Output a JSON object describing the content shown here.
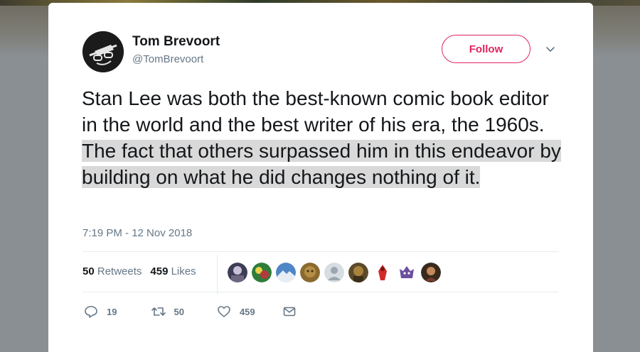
{
  "tweet": {
    "author_name": "Tom Brevoort",
    "author_handle": "@TomBrevoort",
    "follow_label": "Follow",
    "text_plain": "Stan Lee was both the best-known comic book editor in the world and the best writer of his era, the 1960s.",
    "text_highlighted": "The fact that others surpassed him in this endeavor by building on what he did changes nothing of it.",
    "timestamp": "7:19 PM - 12 Nov 2018"
  },
  "stats": {
    "retweets_count": "50",
    "retweets_label": "Retweets",
    "likes_count": "459",
    "likes_label": "Likes"
  },
  "actions": {
    "reply_count": "19",
    "retweet_count": "50",
    "like_count": "459"
  },
  "icons": {
    "follow_menu": "chevron-down-icon",
    "reply": "reply-icon",
    "retweet": "retweet-icon",
    "like": "heart-icon",
    "message": "envelope-icon"
  },
  "colors": {
    "follow_accent": "#e0245e",
    "secondary_text": "#657786",
    "primary_text": "#14171a",
    "highlight": "#d9d9d9"
  }
}
